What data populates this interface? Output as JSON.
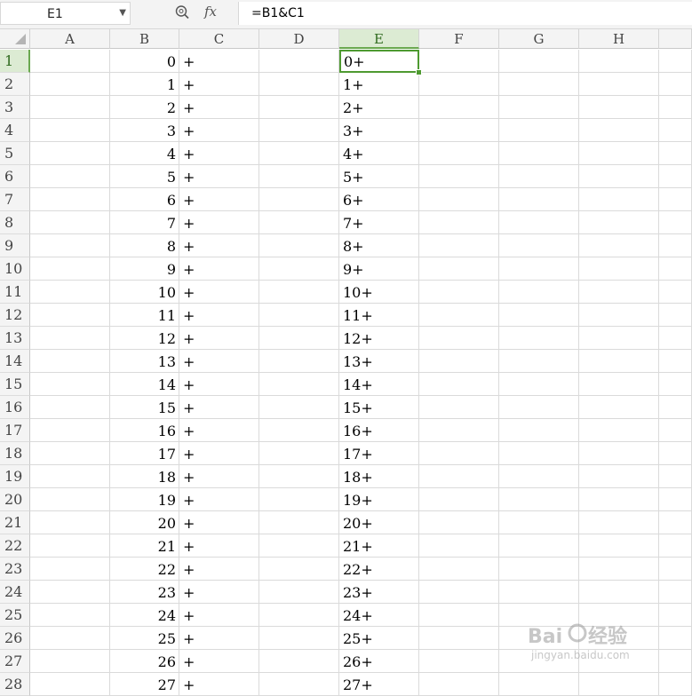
{
  "name_box": {
    "value": "E1"
  },
  "formula_bar": {
    "zoom_icon": "magnifier-icon",
    "fx_label": "fx",
    "formula": "=B1&C1"
  },
  "columns": [
    "A",
    "B",
    "C",
    "D",
    "E",
    "F",
    "G",
    "H"
  ],
  "selected_column": "E",
  "selected_row": "1",
  "rows": [
    {
      "row": "1",
      "B": "0",
      "C": "+",
      "E": "0+"
    },
    {
      "row": "2",
      "B": "1",
      "C": "+",
      "E": "1+"
    },
    {
      "row": "3",
      "B": "2",
      "C": "+",
      "E": "2+"
    },
    {
      "row": "4",
      "B": "3",
      "C": "+",
      "E": "3+"
    },
    {
      "row": "5",
      "B": "4",
      "C": "+",
      "E": "4+"
    },
    {
      "row": "6",
      "B": "5",
      "C": "+",
      "E": "5+"
    },
    {
      "row": "7",
      "B": "6",
      "C": "+",
      "E": "6+"
    },
    {
      "row": "8",
      "B": "7",
      "C": "+",
      "E": "7+"
    },
    {
      "row": "9",
      "B": "8",
      "C": "+",
      "E": "8+"
    },
    {
      "row": "10",
      "B": "9",
      "C": "+",
      "E": "9+"
    },
    {
      "row": "11",
      "B": "10",
      "C": "+",
      "E": "10+"
    },
    {
      "row": "12",
      "B": "11",
      "C": "+",
      "E": "11+"
    },
    {
      "row": "13",
      "B": "12",
      "C": "+",
      "E": "12+"
    },
    {
      "row": "14",
      "B": "13",
      "C": "+",
      "E": "13+"
    },
    {
      "row": "15",
      "B": "14",
      "C": "+",
      "E": "14+"
    },
    {
      "row": "16",
      "B": "15",
      "C": "+",
      "E": "15+"
    },
    {
      "row": "17",
      "B": "16",
      "C": "+",
      "E": "16+"
    },
    {
      "row": "18",
      "B": "17",
      "C": "+",
      "E": "17+"
    },
    {
      "row": "19",
      "B": "18",
      "C": "+",
      "E": "18+"
    },
    {
      "row": "20",
      "B": "19",
      "C": "+",
      "E": "19+"
    },
    {
      "row": "21",
      "B": "20",
      "C": "+",
      "E": "20+"
    },
    {
      "row": "22",
      "B": "21",
      "C": "+",
      "E": "21+"
    },
    {
      "row": "23",
      "B": "22",
      "C": "+",
      "E": "22+"
    },
    {
      "row": "24",
      "B": "23",
      "C": "+",
      "E": "23+"
    },
    {
      "row": "25",
      "B": "24",
      "C": "+",
      "E": "24+"
    },
    {
      "row": "26",
      "B": "25",
      "C": "+",
      "E": "25+"
    },
    {
      "row": "27",
      "B": "26",
      "C": "+",
      "E": "26+"
    },
    {
      "row": "28",
      "B": "27",
      "C": "+",
      "E": "27+"
    }
  ],
  "colors": {
    "selection": "#4e9a31",
    "selected_header": "#dcebd3"
  },
  "watermark": {
    "brand": "Baidu",
    "brand_cn": "经验",
    "url": "jingyan.baidu.com"
  }
}
